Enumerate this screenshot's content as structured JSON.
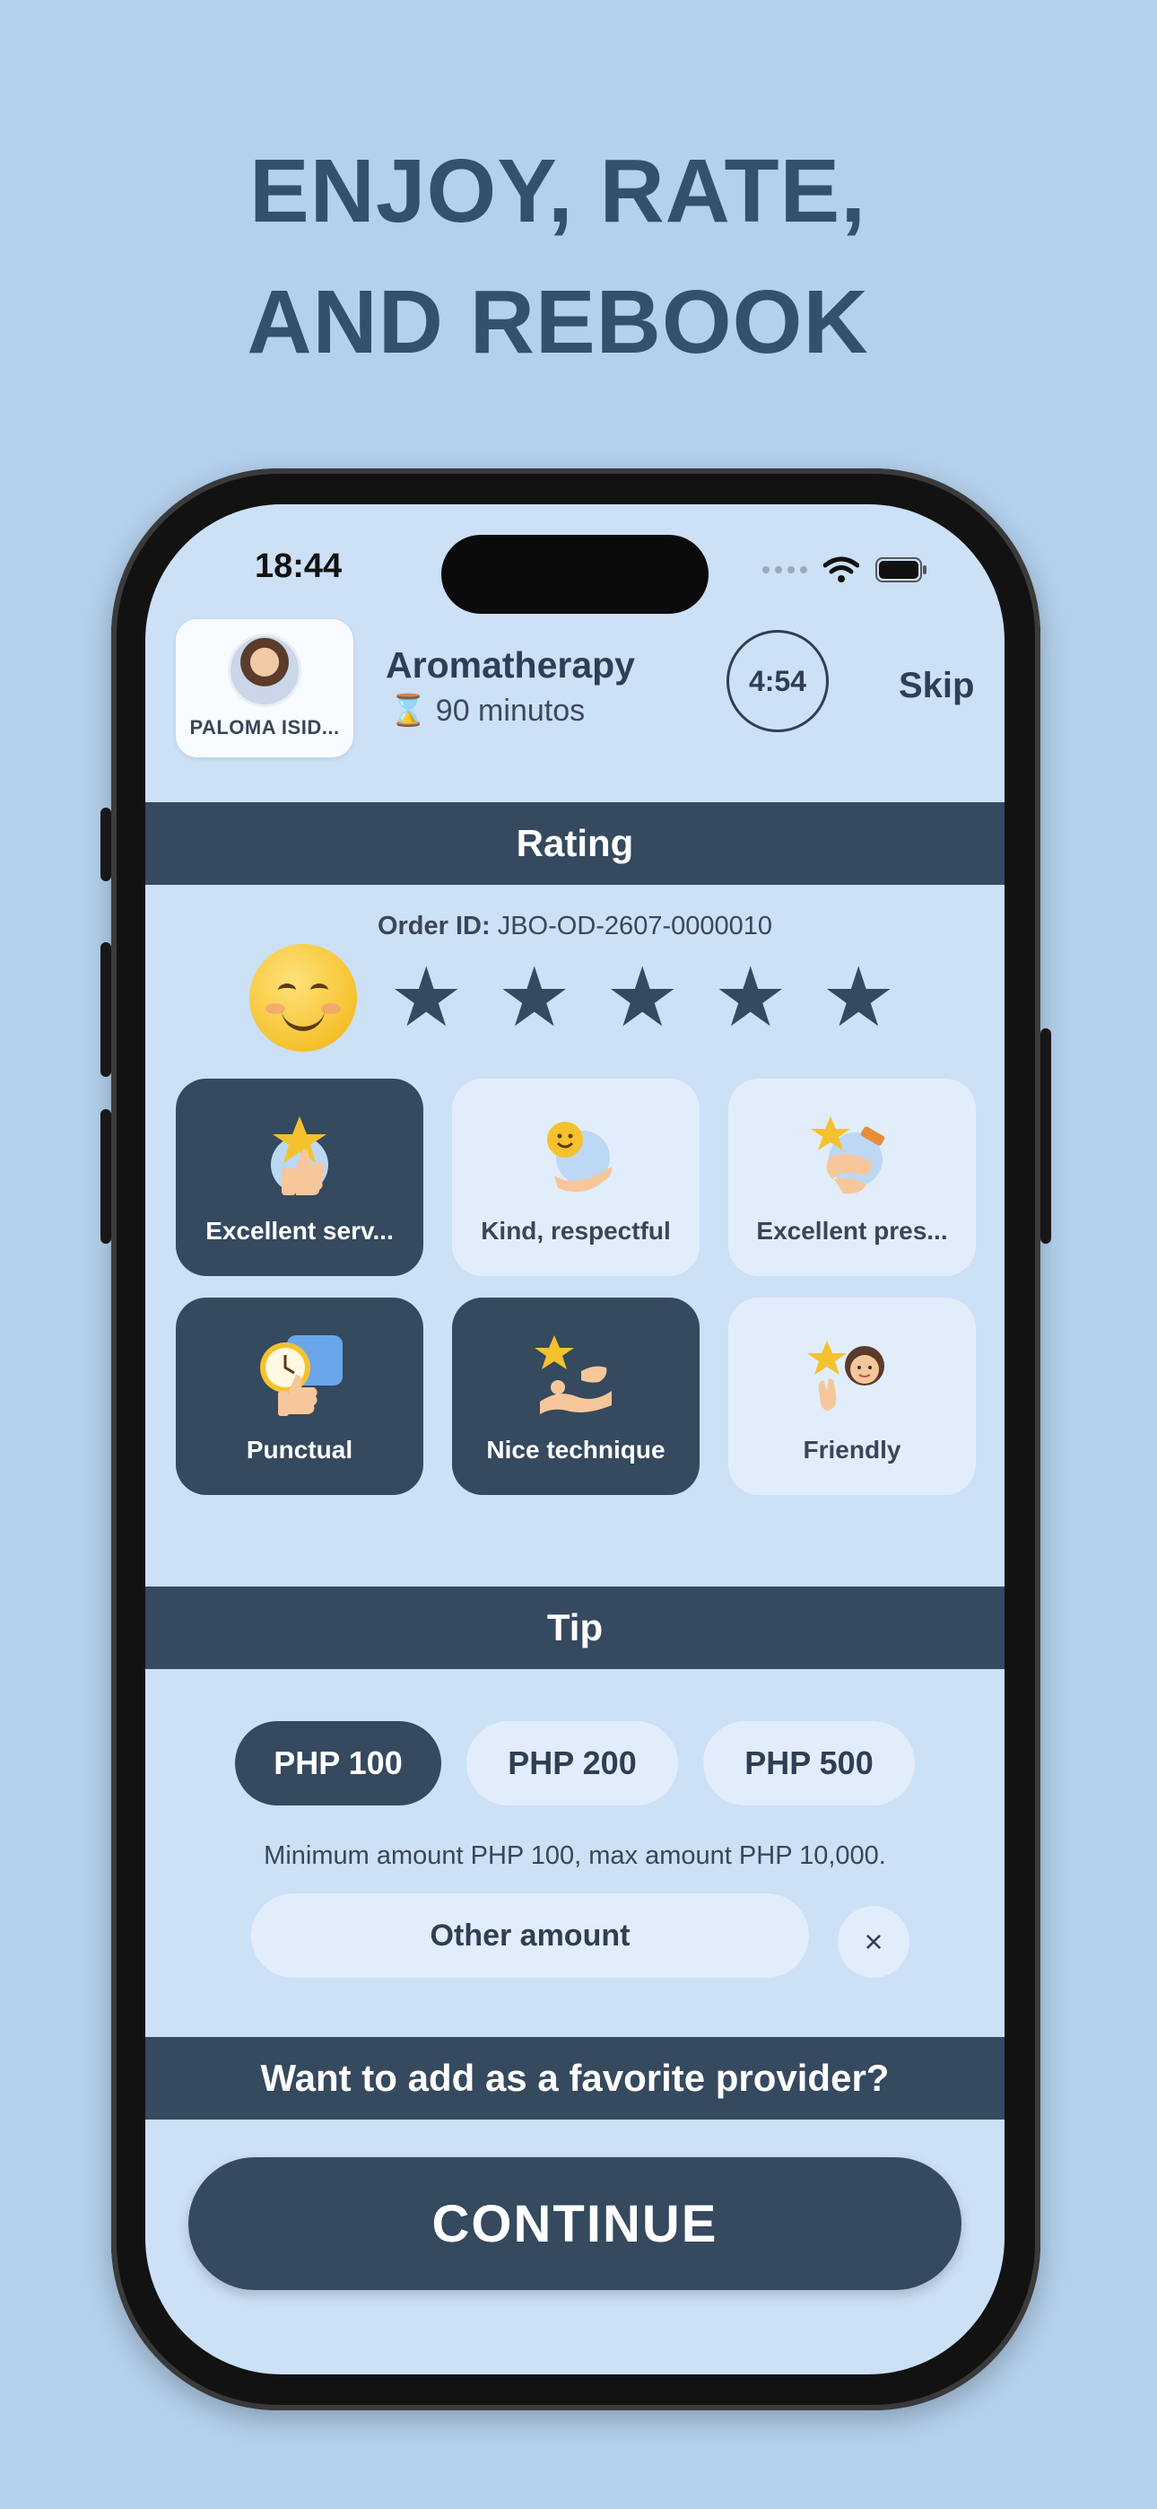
{
  "promo": {
    "line1": "ENJOY, RATE,",
    "line2": "AND REBOOK"
  },
  "status_bar": {
    "time": "18:44",
    "icons": [
      "signal-dots-icon",
      "wifi-icon",
      "battery-icon"
    ]
  },
  "header": {
    "provider_name": "PALOMA ISID...",
    "service_title": "Aromatherapy",
    "duration_icon": "hourglass-icon",
    "duration_text": "90 minutos",
    "timer": "4:54",
    "skip_label": "Skip"
  },
  "rating": {
    "section_title": "Rating",
    "order_id_label": "Order ID:",
    "order_id_value": "JBO-OD-2607-0000010",
    "face": "smiling-face-icon",
    "stars_selected": 5,
    "stars_max": 5,
    "tags": [
      {
        "label": "Excellent serv...",
        "icon": "star-thumbs-up-icon",
        "selected": true
      },
      {
        "label": "Kind, respectful",
        "icon": "smile-hand-icon",
        "selected": false
      },
      {
        "label": "Excellent pres...",
        "icon": "star-pressure-icon",
        "selected": false
      },
      {
        "label": "Punctual",
        "icon": "clock-thumbs-up-icon",
        "selected": true
      },
      {
        "label": "Nice technique",
        "icon": "star-massage-icon",
        "selected": true
      },
      {
        "label": "Friendly",
        "icon": "star-wave-person-icon",
        "selected": false
      }
    ]
  },
  "tip": {
    "section_title": "Tip",
    "options": [
      {
        "label": "PHP 100",
        "selected": true
      },
      {
        "label": "PHP 200",
        "selected": false
      },
      {
        "label": "PHP 500",
        "selected": false
      }
    ],
    "note": "Minimum amount PHP 100, max amount PHP 10,000.",
    "other_amount_label": "Other amount",
    "clear_symbol": "×"
  },
  "favorite": {
    "section_title": "Want to add as a favorite provider?"
  },
  "continue_label": "CONTINUE",
  "colors": {
    "background": "#b4d0ec",
    "screen": "#cce0f6",
    "accent_dark": "#35495f",
    "chip_light": "#e2edfb",
    "headline": "#34506f"
  }
}
